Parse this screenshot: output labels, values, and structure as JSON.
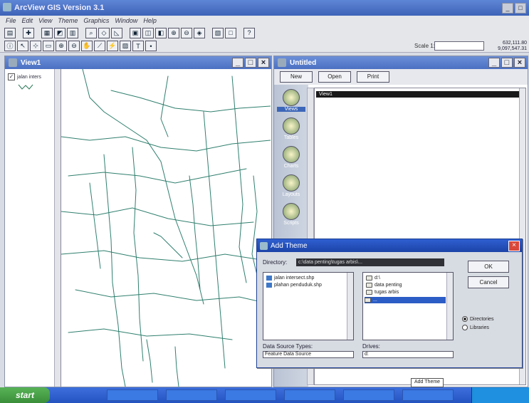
{
  "app": {
    "title": "ArcView GIS Version 3.1"
  },
  "menu": [
    "File",
    "Edit",
    "View",
    "Theme",
    "Graphics",
    "Window",
    "Help"
  ],
  "scale": {
    "label": "Scale 1:",
    "value": ""
  },
  "coords": {
    "x": "632,111.80",
    "y": "9,097,547.31"
  },
  "view": {
    "title": "View1",
    "toc_item": "jalan inters"
  },
  "project": {
    "title": "Untitled",
    "buttons": [
      "New",
      "Open",
      "Print"
    ],
    "items": [
      "Views",
      "Tables",
      "Charts",
      "Layouts",
      "Scripts"
    ],
    "selected_doc": "View1"
  },
  "dialog": {
    "title": "Add Theme",
    "directory_label": "Directory:",
    "directory_value": "c:\\data penting\\tugas arbis\\...",
    "files": [
      "jalan intersect.shp",
      "plahan penduduk.shp"
    ],
    "folders": [
      "d:\\",
      "data penting",
      "tugas arbis",
      "..."
    ],
    "ok_label": "OK",
    "cancel_label": "Cancel",
    "source_types_label": "Data Source Types:",
    "source_type_value": "Feature Data Source",
    "drives_label": "Drives:",
    "drive_value": "d:",
    "radio_directories": "Directories",
    "radio_libraries": "Libraries"
  },
  "tooltip": "Add Theme",
  "taskbar": {
    "start": "start",
    "tasks": [
      "",
      "",
      "",
      "",
      "",
      "",
      ""
    ]
  }
}
